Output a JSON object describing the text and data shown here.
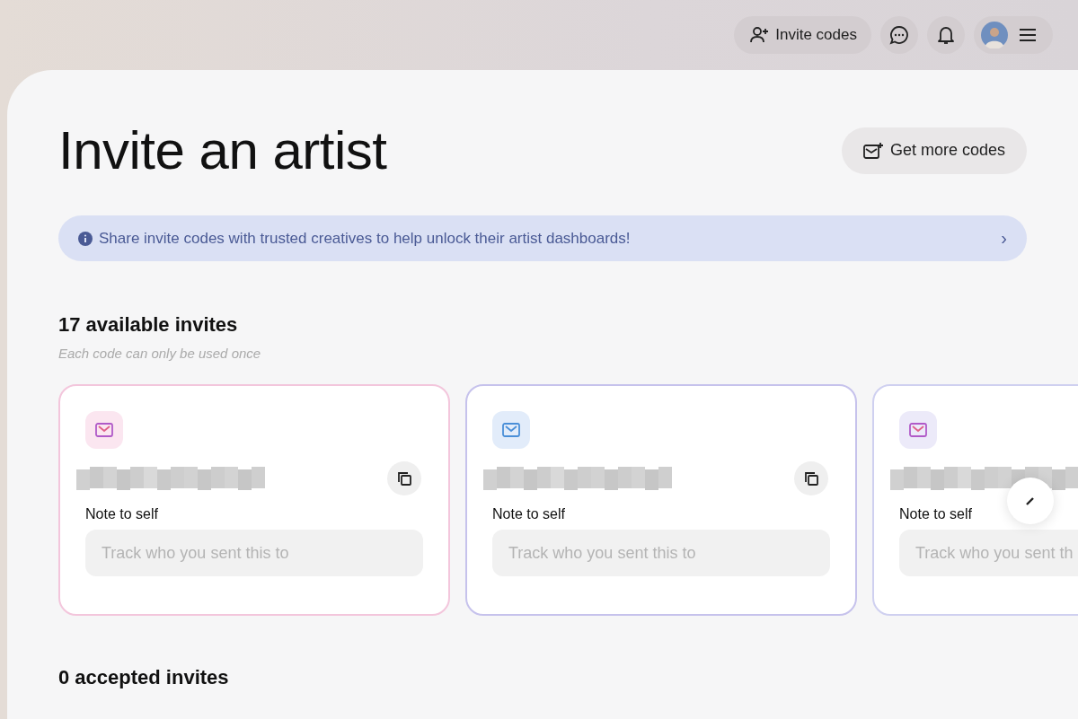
{
  "top_bar": {
    "invite_button": "Invite codes"
  },
  "page": {
    "title": "Invite an artist",
    "get_more_button": "Get more codes",
    "banner": {
      "text": "Share invite codes with trusted creatives to help unlock their artist dashboards!",
      "chevron": "›"
    },
    "available": {
      "heading": "17 available invites",
      "subtitle": "Each code can only be used once"
    },
    "cards": [
      {
        "note_label": "Note to self",
        "placeholder": "Track who you sent this to",
        "copyable": true
      },
      {
        "note_label": "Note to self",
        "placeholder": "Track who you sent this to",
        "copyable": true
      },
      {
        "note_label": "Note to self",
        "placeholder": "Track who you sent th",
        "copyable": false
      }
    ],
    "accepted": {
      "heading": "0 accepted invites"
    }
  }
}
